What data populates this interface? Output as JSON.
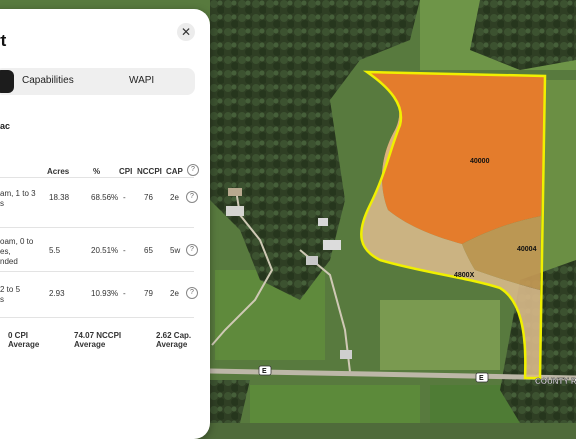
{
  "panel": {
    "title": "rt",
    "close_glyph": "✕",
    "tabs": [
      "Capabilities",
      "WAPI"
    ],
    "total_acres": "ac",
    "columns": {
      "acres": "Acres",
      "pct": "%",
      "cpi": "CPI",
      "nccpi": "NCCPI",
      "cap": "CAP"
    },
    "help_glyph": "?",
    "rows": [
      {
        "desc": [
          "am, 1 to 3",
          "s"
        ],
        "acres": "18.38",
        "pct": "68.56%",
        "cpi": "-",
        "nccpi": "76",
        "cap": "2e"
      },
      {
        "desc": [
          "oam, 0 to",
          "es,",
          "nded"
        ],
        "acres": "5.5",
        "pct": "20.51%",
        "cpi": "-",
        "nccpi": "65",
        "cap": "5w"
      },
      {
        "desc": [
          "2 to 5",
          "s"
        ],
        "acres": "2.93",
        "pct": "10.93%",
        "cpi": "-",
        "nccpi": "79",
        "cap": "2e"
      }
    ],
    "averages": {
      "cpi": [
        "0 CPI",
        "Average"
      ],
      "nccpi": [
        "74.07 NCCPI",
        "Average"
      ],
      "cap": [
        "2.62 Cap.",
        "Average"
      ]
    }
  },
  "map": {
    "parcel_labels": {
      "main": "40000",
      "east": "40004",
      "south": "4800X"
    },
    "road_shields": [
      "E",
      "E"
    ],
    "road_name": "COUNTY R",
    "colors": {
      "boundary": "#f0f000",
      "main_zone": "#f07c2a",
      "east_zone": "#c79a55",
      "south_zone": "#d8b98a"
    }
  }
}
